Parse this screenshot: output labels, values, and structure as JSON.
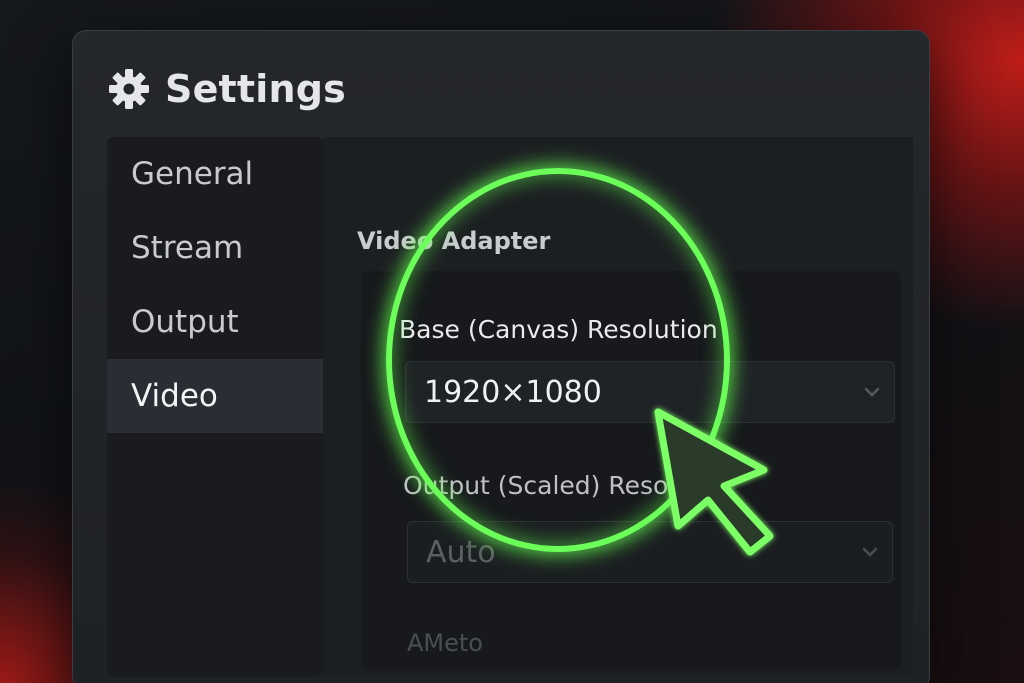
{
  "window": {
    "title": "Settings"
  },
  "sidebar": {
    "items": [
      {
        "label": "General",
        "active": false
      },
      {
        "label": "Stream",
        "active": false
      },
      {
        "label": "Output",
        "active": false
      },
      {
        "label": "Video",
        "active": true
      }
    ]
  },
  "main": {
    "section_title": "Video Adapter",
    "base_resolution": {
      "label": "Base (Canvas) Resolution",
      "value": "1920×1080"
    },
    "output_resolution": {
      "label": "Output (Scaled) Resolu",
      "value": "Auto"
    },
    "next_field_label": "AMeto"
  },
  "highlight": {
    "color": "#6cff5a"
  },
  "icons": [
    "gear-icon",
    "chevron-down-icon",
    "cursor-icon"
  ]
}
